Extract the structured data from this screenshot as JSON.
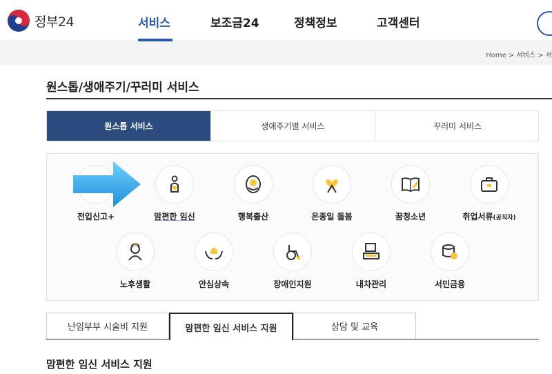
{
  "header": {
    "logo_text": "정부24",
    "nav": [
      "서비스",
      "보조금24",
      "정책정보",
      "고객센터"
    ]
  },
  "breadcrumb": "Home  >  서비스  >  서",
  "page_title": "원스톱/생애주기/꾸러미 서비스",
  "top_tabs": [
    "원스톱 서비스",
    "생애주기별 서비스",
    "꾸러미 서비스"
  ],
  "services": [
    {
      "label": "전입신고+",
      "icon": "house-icon"
    },
    {
      "label": "맘편한 임신",
      "icon": "pregnant-woman-icon"
    },
    {
      "label": "행복출산",
      "icon": "baby-icon"
    },
    {
      "label": "온종일 돌봄",
      "icon": "heart-ribbon-icon"
    },
    {
      "label": "꿈청소년",
      "icon": "book-pencil-icon"
    },
    {
      "label": "취업서류",
      "label_small": "(공직자)",
      "icon": "briefcase-icon"
    },
    {
      "label": "노후생활",
      "icon": "elder-icon"
    },
    {
      "label": "안심상속",
      "icon": "hands-house-icon"
    },
    {
      "label": "장애인지원",
      "icon": "wheelchair-icon"
    },
    {
      "label": "내차관리",
      "icon": "car-icon"
    },
    {
      "label": "서민금융",
      "icon": "coins-icon"
    }
  ],
  "sub_tabs": [
    "난임부부 시술비 지원",
    "맘편한 임신 서비스 지원",
    "상담 및 교육"
  ],
  "section_title": "맘편한 임신 서비스 지원",
  "colors": {
    "brand": "#2a56a7",
    "tab_active": "#2c4c80",
    "icon_yellow": "#f5c63b",
    "arrow": "#2aa0e6"
  }
}
